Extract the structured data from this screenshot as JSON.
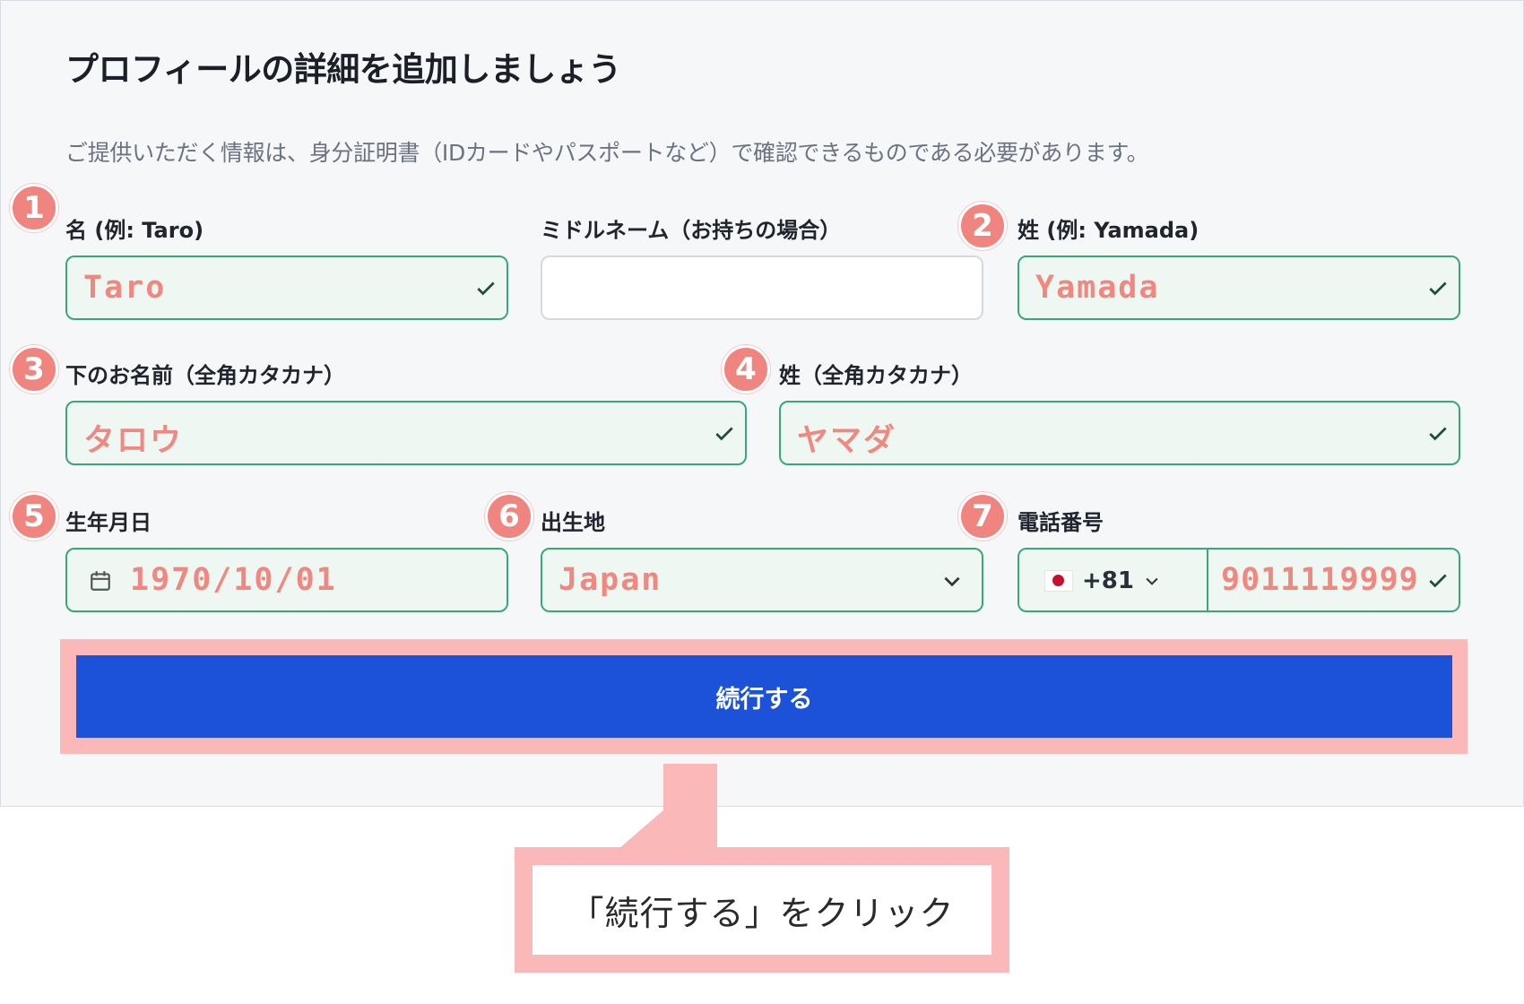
{
  "form": {
    "title": "プロフィールの詳細を追加しましょう",
    "subtitle": "ご提供いただく情報は、身分証明書（IDカードやパスポートなど）で確認できるものである必要があります。",
    "fields": {
      "first_name": {
        "badge": "1",
        "label": "名 (例: Taro)",
        "value": "Taro"
      },
      "middle_name": {
        "label": "ミドルネーム（お持ちの場合）",
        "value": ""
      },
      "last_name": {
        "badge": "2",
        "label": "姓 (例: Yamada)",
        "value": "Yamada"
      },
      "first_name_kana": {
        "badge": "3",
        "label": "下のお名前（全角カタカナ）",
        "value": "タロウ"
      },
      "last_name_kana": {
        "badge": "4",
        "label": "姓（全角カタカナ）",
        "value": "ヤマダ"
      },
      "birthdate": {
        "badge": "5",
        "label": "生年月日",
        "value": "1970/10/01",
        "icon": "calendar-icon"
      },
      "birthplace": {
        "badge": "6",
        "label": "出生地",
        "value": "Japan",
        "icon": "chevron-down-icon"
      },
      "phone": {
        "badge": "7",
        "label": "電話番号",
        "country_code": "+81",
        "country_flag": "japan-flag-icon",
        "value": "9011119999"
      }
    },
    "continue_label": "続行する"
  },
  "callout": {
    "text": "「続行する」をクリック"
  },
  "colors": {
    "accent": "#1b52d8",
    "valid_border": "#3aa67a",
    "annotation": "#f0847f",
    "highlight": "#fbb8b8"
  }
}
